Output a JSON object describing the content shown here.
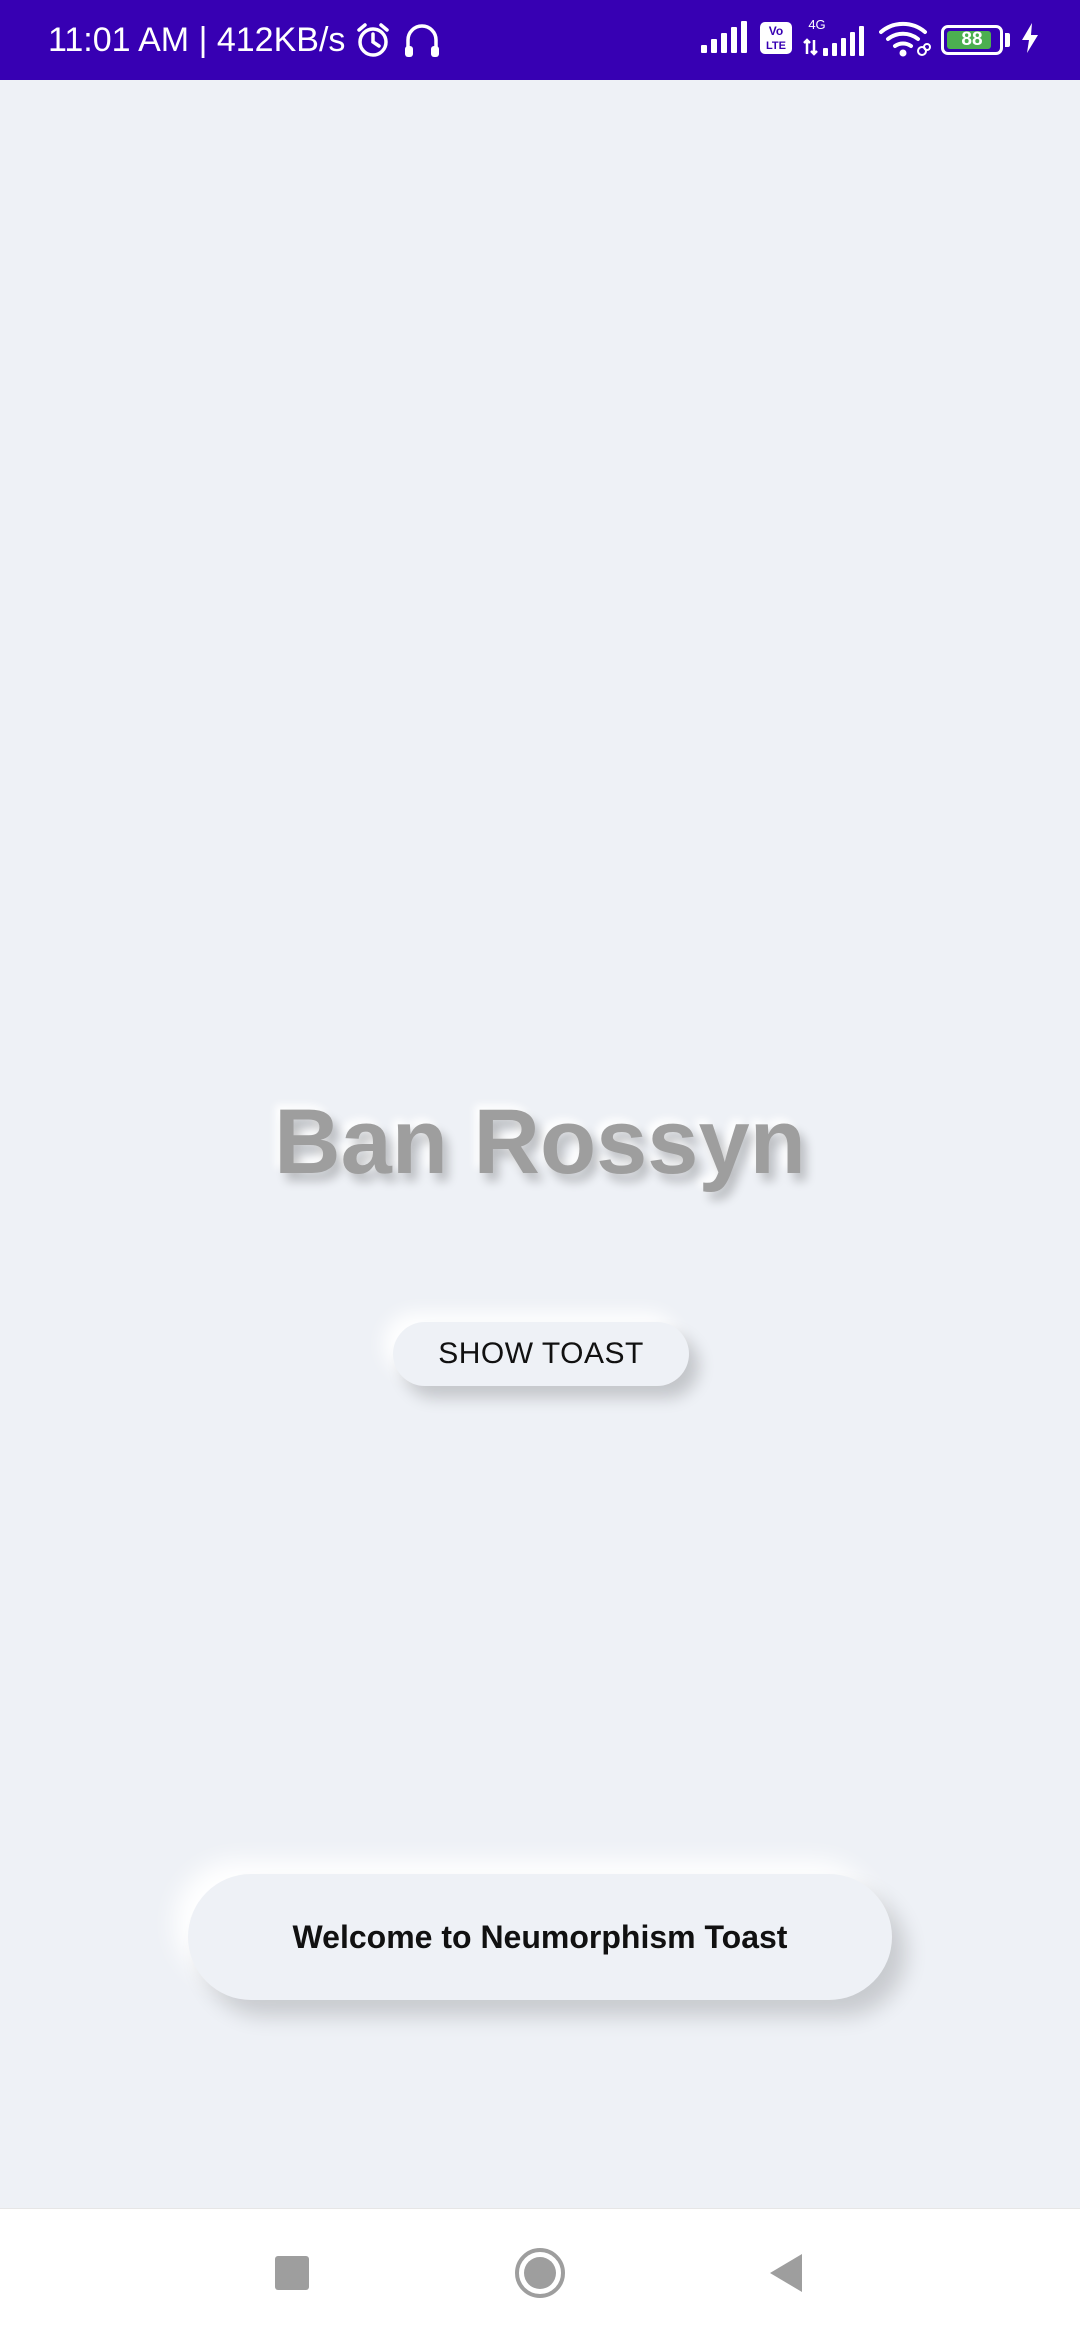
{
  "status_bar": {
    "time_speed": "11:01 AM | 412KB/s",
    "icons": [
      "alarm-icon",
      "headphones-icon",
      "signal-icon",
      "volte-icon",
      "signal-4g-icon",
      "wifi-icon",
      "battery-icon",
      "charging-icon"
    ],
    "network_type": "4G",
    "volte_top": "Vo",
    "volte_bottom": "LTE",
    "battery_level": "88",
    "battery_fraction": 0.88,
    "background_color": "#3700b3"
  },
  "main": {
    "title": "Ban Rossyn",
    "show_toast_label": "SHOW TOAST",
    "background_color": "#eef1f6",
    "title_color": "#9e9e9e"
  },
  "toast": {
    "message": "Welcome to Neumorphism Toast"
  },
  "nav_bar": {
    "icons": [
      "recents-icon",
      "home-icon",
      "back-icon"
    ]
  }
}
